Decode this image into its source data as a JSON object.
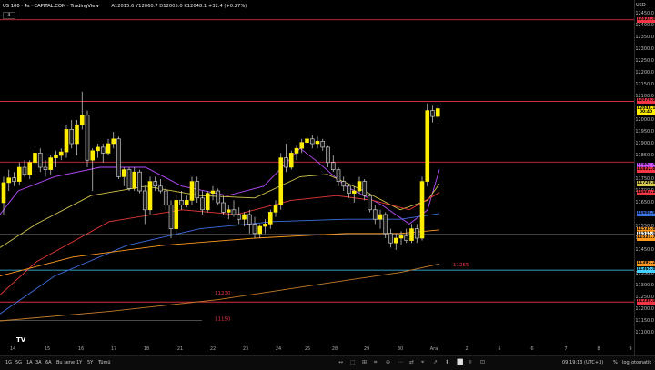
{
  "header": {
    "symbol": "US 100 · 4s · CAPITAL.COM · TradingView",
    "quote": "A12015.6 Y12060.7 D12005.0 K12048.1 +32.4 (+0.27%)",
    "collapse": "3"
  },
  "axis": {
    "currency": "USD",
    "ticks": [
      "12450.0",
      "12400.0",
      "12350.0",
      "12300.0",
      "12250.0",
      "12200.0",
      "12150.0",
      "12100.0",
      "12000.0",
      "11950.0",
      "11900.0",
      "11850.0",
      "11750.0",
      "11700.0",
      "11650.0",
      "11550.0",
      "11500.0",
      "11450.0",
      "11350.0",
      "11300.0",
      "11250.0",
      "11200.0",
      "11150.0",
      "11100.0"
    ],
    "tags": [
      {
        "label": "12424.0",
        "color": "#f23645",
        "price": 12424
      },
      {
        "label": "12079.0",
        "color": "#f23645",
        "price": 12079
      },
      {
        "label": "12048.1",
        "color": "#ffee00",
        "price": 12048
      },
      {
        "label": "00:40",
        "color": "#ffee00",
        "price": 12030
      },
      {
        "label": "11807.4",
        "color": "#cc55ff",
        "price": 11807
      },
      {
        "label": "11822.0",
        "color": "#f23645",
        "price": 11790
      },
      {
        "label": "11729.8",
        "color": "#d6c84a",
        "price": 11729
      },
      {
        "label": "11693.2",
        "color": "#f23645",
        "price": 11693
      },
      {
        "label": "11604.9",
        "color": "#3d6ee0",
        "price": 11604
      },
      {
        "label": "11535.0",
        "color": "#ff9a1f",
        "price": 11535
      },
      {
        "label": "11515.0",
        "color": "#ffffff",
        "price": 11515
      },
      {
        "label": "11524.7",
        "color": "#ff9a1f",
        "price": 11500
      },
      {
        "label": "11391.2",
        "color": "#ff9a1f",
        "price": 11391
      },
      {
        "label": "11365.0",
        "color": "#44d0ff",
        "price": 11365
      },
      {
        "label": "11230.0",
        "color": "#f23645",
        "price": 11230
      }
    ]
  },
  "levels": [
    {
      "price": 12424,
      "color": "#f23645",
      "label": ""
    },
    {
      "price": 12079,
      "color": "#f23645",
      "label": ""
    },
    {
      "price": 11822,
      "color": "#f23645",
      "label": ""
    },
    {
      "price": 11515,
      "color": "#ffffff",
      "label": ""
    },
    {
      "price": 11365,
      "color": "#44d0ff",
      "label": ""
    },
    {
      "price": 11230,
      "color": "#f23645",
      "label": ""
    }
  ],
  "annotations": [
    {
      "text": "11255",
      "price": 11380,
      "x": 498,
      "color": "#f23645"
    },
    {
      "text": "11230",
      "price": 11262,
      "x": 236,
      "color": "#f23645"
    },
    {
      "text": "11150",
      "price": 11152,
      "x": 236,
      "color": "#f23645"
    }
  ],
  "xaxis": {
    "labels": [
      {
        "t": "14",
        "x": 14
      },
      {
        "t": "15",
        "x": 52
      },
      {
        "t": "16",
        "x": 89
      },
      {
        "t": "17",
        "x": 125
      },
      {
        "t": "18",
        "x": 161
      },
      {
        "t": "21",
        "x": 198
      },
      {
        "t": "22",
        "x": 234
      },
      {
        "t": "23",
        "x": 270
      },
      {
        "t": "24",
        "x": 306
      },
      {
        "t": "25",
        "x": 338
      },
      {
        "t": "28",
        "x": 368
      },
      {
        "t": "29",
        "x": 403
      },
      {
        "t": "30",
        "x": 440
      },
      {
        "t": "Ara",
        "x": 477
      },
      {
        "t": "2",
        "x": 513
      },
      {
        "t": "5",
        "x": 549
      },
      {
        "t": "6",
        "x": 585
      },
      {
        "t": "7",
        "x": 622
      },
      {
        "t": "8",
        "x": 658
      },
      {
        "t": "9",
        "x": 693
      }
    ]
  },
  "chart_data": {
    "type": "candlestick",
    "ylim": [
      11080,
      12480
    ],
    "candles": [
      [
        11650,
        11760,
        11600,
        11735
      ],
      [
        11735,
        11790,
        11700,
        11755
      ],
      [
        11755,
        11780,
        11720,
        11740
      ],
      [
        11740,
        11820,
        11725,
        11800
      ],
      [
        11800,
        11830,
        11760,
        11770
      ],
      [
        11770,
        11830,
        11750,
        11820
      ],
      [
        11820,
        11890,
        11780,
        11860
      ],
      [
        11860,
        11880,
        11780,
        11800
      ],
      [
        11800,
        11830,
        11760,
        11790
      ],
      [
        11790,
        11850,
        11770,
        11840
      ],
      [
        11840,
        11870,
        11800,
        11850
      ],
      [
        11850,
        11880,
        11830,
        11865
      ],
      [
        11865,
        11980,
        11840,
        11960
      ],
      [
        11960,
        12000,
        11880,
        11900
      ],
      [
        11900,
        12000,
        11850,
        11980
      ],
      [
        11980,
        12120,
        11960,
        12020
      ],
      [
        12020,
        12040,
        11800,
        11830
      ],
      [
        11830,
        11880,
        11700,
        11870
      ],
      [
        11870,
        11900,
        11840,
        11885
      ],
      [
        11885,
        11900,
        11820,
        11860
      ],
      [
        11860,
        11920,
        11850,
        11900
      ],
      [
        11900,
        11950,
        11880,
        11920
      ],
      [
        11920,
        11930,
        11750,
        11760
      ],
      [
        11760,
        11800,
        11720,
        11790
      ],
      [
        11790,
        11800,
        11700,
        11710
      ],
      [
        11710,
        11800,
        11700,
        11780
      ],
      [
        11780,
        11790,
        11690,
        11700
      ],
      [
        11700,
        11720,
        11560,
        11620
      ],
      [
        11620,
        11760,
        11600,
        11740
      ],
      [
        11740,
        11760,
        11700,
        11720
      ],
      [
        11720,
        11750,
        11690,
        11700
      ],
      [
        11700,
        11720,
        11620,
        11640
      ],
      [
        11640,
        11660,
        11500,
        11540
      ],
      [
        11540,
        11680,
        11520,
        11660
      ],
      [
        11660,
        11700,
        11620,
        11640
      ],
      [
        11640,
        11680,
        11630,
        11660
      ],
      [
        11660,
        11760,
        11640,
        11740
      ],
      [
        11740,
        11760,
        11650,
        11670
      ],
      [
        11670,
        11700,
        11600,
        11620
      ],
      [
        11620,
        11700,
        11610,
        11690
      ],
      [
        11690,
        11720,
        11660,
        11700
      ],
      [
        11700,
        11710,
        11640,
        11650
      ],
      [
        11650,
        11680,
        11600,
        11610
      ],
      [
        11610,
        11640,
        11580,
        11620
      ],
      [
        11620,
        11660,
        11590,
        11600
      ],
      [
        11600,
        11630,
        11560,
        11580
      ],
      [
        11580,
        11610,
        11550,
        11600
      ],
      [
        11600,
        11620,
        11520,
        11560
      ],
      [
        11560,
        11590,
        11500,
        11520
      ],
      [
        11520,
        11560,
        11500,
        11550
      ],
      [
        11550,
        11580,
        11520,
        11560
      ],
      [
        11560,
        11620,
        11540,
        11610
      ],
      [
        11610,
        11660,
        11590,
        11640
      ],
      [
        11640,
        11860,
        11620,
        11840
      ],
      [
        11840,
        11900,
        11780,
        11800
      ],
      [
        11800,
        11870,
        11790,
        11860
      ],
      [
        11860,
        11890,
        11830,
        11880
      ],
      [
        11880,
        11920,
        11860,
        11905
      ],
      [
        11905,
        11940,
        11880,
        11920
      ],
      [
        11920,
        11935,
        11880,
        11900
      ],
      [
        11900,
        11930,
        11880,
        11910
      ],
      [
        11910,
        11920,
        11870,
        11885
      ],
      [
        11885,
        11890,
        11800,
        11820
      ],
      [
        11820,
        11850,
        11780,
        11790
      ],
      [
        11790,
        11800,
        11720,
        11740
      ],
      [
        11740,
        11760,
        11700,
        11720
      ],
      [
        11720,
        11730,
        11670,
        11690
      ],
      [
        11690,
        11720,
        11650,
        11700
      ],
      [
        11700,
        11760,
        11690,
        11740
      ],
      [
        11740,
        11750,
        11660,
        11680
      ],
      [
        11680,
        11690,
        11610,
        11620
      ],
      [
        11620,
        11640,
        11560,
        11580
      ],
      [
        11580,
        11620,
        11540,
        11600
      ],
      [
        11600,
        11610,
        11500,
        11520
      ],
      [
        11520,
        11540,
        11460,
        11480
      ],
      [
        11480,
        11520,
        11450,
        11500
      ],
      [
        11500,
        11530,
        11470,
        11510
      ],
      [
        11510,
        11540,
        11480,
        11490
      ],
      [
        11490,
        11560,
        11480,
        11540
      ],
      [
        11540,
        11560,
        11480,
        11500
      ],
      [
        11500,
        11760,
        11490,
        11740
      ],
      [
        11740,
        12070,
        11720,
        12040
      ],
      [
        12040,
        12060,
        11990,
        12015
      ],
      [
        12015,
        12060,
        12005,
        12048
      ]
    ],
    "moving_averages": [
      {
        "name": "ma-purple",
        "color": "#b84dff",
        "points": [
          [
            0,
            11600
          ],
          [
            20,
            11700
          ],
          [
            60,
            11760
          ],
          [
            110,
            11800
          ],
          [
            160,
            11800
          ],
          [
            200,
            11720
          ],
          [
            250,
            11680
          ],
          [
            290,
            11720
          ],
          [
            330,
            11880
          ],
          [
            350,
            11820
          ],
          [
            380,
            11720
          ],
          [
            420,
            11640
          ],
          [
            450,
            11560
          ],
          [
            470,
            11620
          ],
          [
            483,
            11790
          ]
        ]
      },
      {
        "name": "ma-yellow",
        "color": "#d6c84a",
        "points": [
          [
            0,
            11460
          ],
          [
            40,
            11560
          ],
          [
            100,
            11680
          ],
          [
            160,
            11720
          ],
          [
            220,
            11680
          ],
          [
            280,
            11670
          ],
          [
            330,
            11760
          ],
          [
            360,
            11770
          ],
          [
            400,
            11700
          ],
          [
            440,
            11620
          ],
          [
            470,
            11660
          ],
          [
            483,
            11730
          ]
        ]
      },
      {
        "name": "ma-red",
        "color": "#e53935",
        "points": [
          [
            0,
            11260
          ],
          [
            40,
            11400
          ],
          [
            120,
            11570
          ],
          [
            200,
            11620
          ],
          [
            260,
            11600
          ],
          [
            320,
            11660
          ],
          [
            370,
            11680
          ],
          [
            410,
            11660
          ],
          [
            450,
            11620
          ],
          [
            483,
            11693
          ]
        ]
      },
      {
        "name": "ma-blue",
        "color": "#3d6ee0",
        "points": [
          [
            0,
            11180
          ],
          [
            60,
            11340
          ],
          [
            140,
            11470
          ],
          [
            220,
            11540
          ],
          [
            300,
            11570
          ],
          [
            380,
            11580
          ],
          [
            440,
            11580
          ],
          [
            483,
            11604
          ]
        ]
      },
      {
        "name": "ma-orange",
        "color": "#ff9a1f",
        "points": [
          [
            0,
            11340
          ],
          [
            80,
            11420
          ],
          [
            180,
            11470
          ],
          [
            280,
            11500
          ],
          [
            380,
            11520
          ],
          [
            440,
            11520
          ],
          [
            483,
            11535
          ]
        ]
      },
      {
        "name": "ma-brown",
        "color": "#c77d2a",
        "points": [
          [
            0,
            11150
          ],
          [
            120,
            11190
          ],
          [
            240,
            11240
          ],
          [
            360,
            11310
          ],
          [
            440,
            11355
          ],
          [
            483,
            11391
          ]
        ]
      }
    ]
  },
  "bottombar": {
    "timeframes": [
      "1G",
      "5G",
      "1A",
      "3A",
      "6A",
      "Bu sene",
      "1Y",
      "5Y",
      "Tümü"
    ],
    "tools": [
      "↔",
      "⬚",
      "⊞",
      "⌗",
      "⊕",
      "⋯",
      "⇄",
      "⌖",
      "↗",
      "⬍",
      "⬜",
      "⌾",
      "⊡"
    ],
    "clock": "09:19:13 (UTC+3)",
    "options": [
      "%",
      "log",
      "otomatik"
    ]
  }
}
